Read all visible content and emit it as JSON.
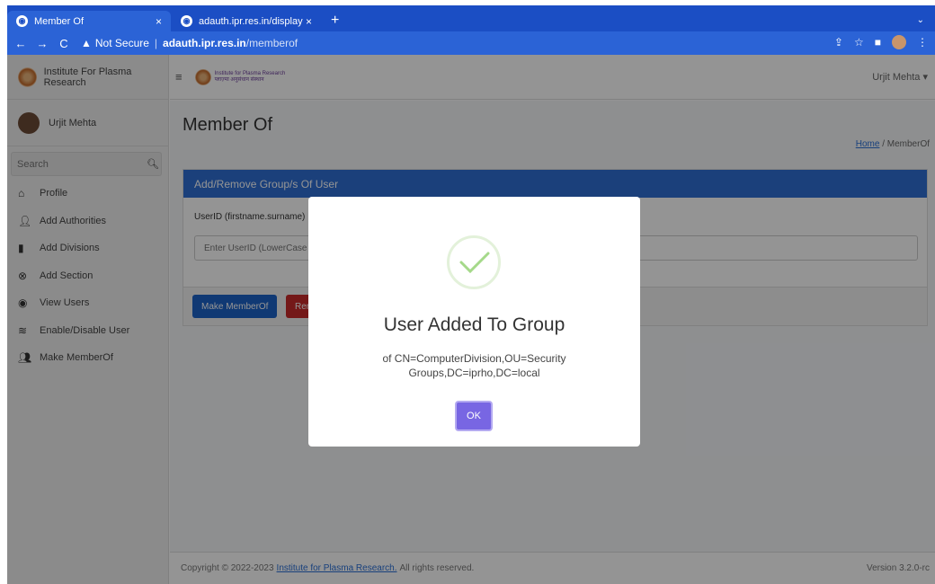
{
  "browser": {
    "tabs": [
      {
        "title": "Member Of",
        "close": "×"
      },
      {
        "title": "adauth.ipr.res.in/display",
        "close": "×"
      }
    ],
    "new_tab": "+",
    "security_label": "Not Secure",
    "url_host": "adauth.ipr.res.in",
    "url_path": "/memberof"
  },
  "sidebar": {
    "brand": "Institute For Plasma Research",
    "user": "Urjit Mehta",
    "search_placeholder": "Search",
    "items": [
      {
        "label": "Profile",
        "icon": "home-icon"
      },
      {
        "label": "Add Authorities",
        "icon": "add-user-icon"
      },
      {
        "label": "Add Divisions",
        "icon": "book-icon"
      },
      {
        "label": "Add Section",
        "icon": "x-circle-icon"
      },
      {
        "label": "View Users",
        "icon": "eye-icon"
      },
      {
        "label": "Enable/Disable User",
        "icon": "hidden-icon"
      },
      {
        "label": "Make MemberOf",
        "icon": "users-icon"
      }
    ]
  },
  "topnav": {
    "logo_text": "Institute for Plasma Research",
    "logo_subtext": "प्लाज़्मा अनुसंधान संस्थान",
    "user": "Urjit Mehta"
  },
  "page": {
    "title": "Member Of",
    "breadcrumb_home": "Home",
    "breadcrumb_current": "MemberOf",
    "card_title": "Add/Remove Group/s Of User",
    "userid_label": "UserID (firstname.surname)",
    "userid_placeholder": "Enter UserID (LowerCase",
    "make_memberof_btn": "Make MemberOf",
    "remove_btn": "Remove"
  },
  "footer": {
    "copyright_prefix": "Copyright © 2022-2023",
    "link": "Institute for Plasma Research.",
    "suffix": "All rights reserved.",
    "version": "Version 3.2.0-rc"
  },
  "modal": {
    "title": "User Added To Group",
    "text": "of CN=ComputerDivision,OU=Security Groups,DC=iprho,DC=local",
    "ok": "OK"
  }
}
